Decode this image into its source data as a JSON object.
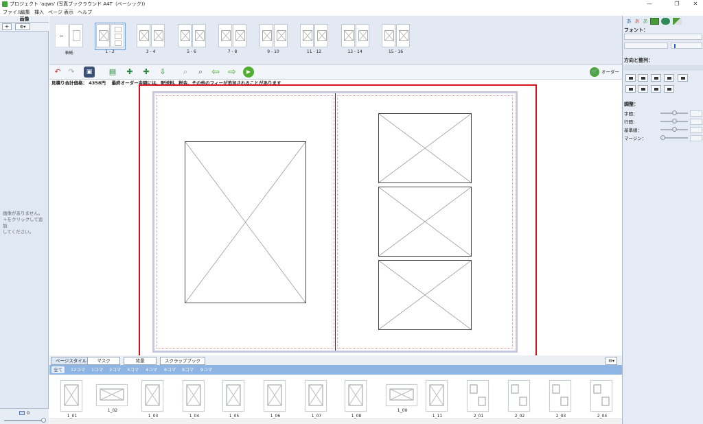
{
  "window": {
    "title": "プロジェクト 'aqws' (写真ブックラウンド A4T（ベーシック))",
    "minimize_glyph": "—",
    "maximize_glyph": "❐",
    "close_glyph": "✕"
  },
  "menu": {
    "items": [
      "ファイル",
      "編集",
      "挿入",
      "ページ",
      "表示",
      "ヘルプ"
    ]
  },
  "left_panel": {
    "title": "画像",
    "add_label": "+",
    "settings_label": "⚙▾",
    "empty_message_lines": [
      "画像がありません。",
      "＋をクリックして追加",
      "してください。"
    ],
    "bottom_count": "0"
  },
  "page_thumbnails": [
    {
      "label": "表紙",
      "pages": 2,
      "selected": false
    },
    {
      "label": "1 - 2",
      "pages": 2,
      "selected": true
    },
    {
      "label": "3 - 4",
      "pages": 2,
      "selected": false
    },
    {
      "label": "5 - 6",
      "pages": 2,
      "selected": false
    },
    {
      "label": "7 - 8",
      "pages": 2,
      "selected": false
    },
    {
      "label": "9 - 10",
      "pages": 2,
      "selected": false
    },
    {
      "label": "11 - 12",
      "pages": 2,
      "selected": false
    },
    {
      "label": "13 - 14",
      "pages": 2,
      "selected": false
    },
    {
      "label": "15 - 16",
      "pages": 2,
      "selected": false
    }
  ],
  "toolbar": {
    "icons": [
      "undo-icon",
      "redo-icon",
      "save-icon",
      "add-page-icon",
      "add-spread-icon",
      "insert-page-icon",
      "import-icon",
      "zoom-out-icon",
      "zoom-in-icon",
      "prev-page-icon",
      "next-page-icon",
      "play-icon"
    ],
    "order_label": "オーダー"
  },
  "estimate": {
    "text": "見積り合計価格： 4358円　 最終オーダー金額には、配送料、税金、その他のフィーが追加されることがあります"
  },
  "bottom_tabs": {
    "tabs": [
      "ページスタイル",
      "マスク",
      "背景",
      "スクラップブック"
    ],
    "active": 0,
    "settings_label": "⚙▾"
  },
  "filters": {
    "items": [
      "全て",
      "12コマ",
      "1コマ",
      "2コマ",
      "3コマ",
      "4コマ",
      "6コマ",
      "8コマ",
      "9コマ"
    ],
    "active": 0
  },
  "page_styles": [
    "1_01",
    "1_02",
    "1_03",
    "1_04",
    "1_05",
    "1_06",
    "1_07",
    "1_08",
    "1_09",
    "1_11",
    "2_01",
    "2_02",
    "2_03",
    "2_04"
  ],
  "right_panel": {
    "tab_labels": [
      "あ",
      "あ",
      "あ",
      "",
      "",
      ""
    ],
    "font_label": "フォント：",
    "direction_label": "方向と整列：",
    "adjust_label": "調整：",
    "adjust_items": [
      {
        "label": "字間：",
        "value": 0.5
      },
      {
        "label": "行間：",
        "value": 0.5
      },
      {
        "label": "基準線：",
        "value": 0.5
      },
      {
        "label": "マージン：",
        "value": 0.0
      }
    ]
  }
}
